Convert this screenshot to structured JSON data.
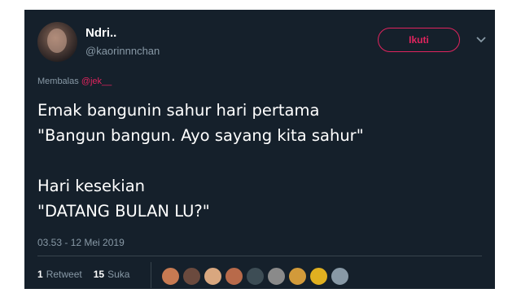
{
  "author": {
    "name": "Ndri..",
    "handle": "@kaorinnnchan"
  },
  "follow_button": "Ikuti",
  "reply": {
    "prefix": "Membalas",
    "mention": "@jek__"
  },
  "tweet": {
    "lines": [
      "Emak bangunin sahur hari pertama",
      "\"Bangun bangun. Ayo sayang kita sahur\"",
      "",
      "Hari kesekian",
      "\"DATANG BULAN LU?\""
    ]
  },
  "timestamp": "03.53 - 12 Mei 2019",
  "stats": {
    "retweets_count": "1",
    "retweets_label": "Retweet",
    "likes_count": "15",
    "likes_label": "Suka"
  },
  "likers": [
    {
      "icon": "liker-avatar",
      "color": "#c77a52"
    },
    {
      "icon": "liker-avatar",
      "color": "#6b4a3e"
    },
    {
      "icon": "liker-avatar",
      "color": "#d9a77f"
    },
    {
      "icon": "liker-avatar",
      "color": "#b86a4a"
    },
    {
      "icon": "liker-avatar",
      "color": "#3d4d55"
    },
    {
      "icon": "liker-avatar",
      "color": "#8a8a8a"
    },
    {
      "icon": "liker-avatar",
      "color": "#d29a3a"
    },
    {
      "icon": "liker-avatar",
      "color": "#e0b020"
    },
    {
      "icon": "default-avatar",
      "color": "#8899a6"
    }
  ],
  "colors": {
    "background": "#15202b",
    "accent": "#e0245e",
    "secondary_text": "#8899a6"
  }
}
